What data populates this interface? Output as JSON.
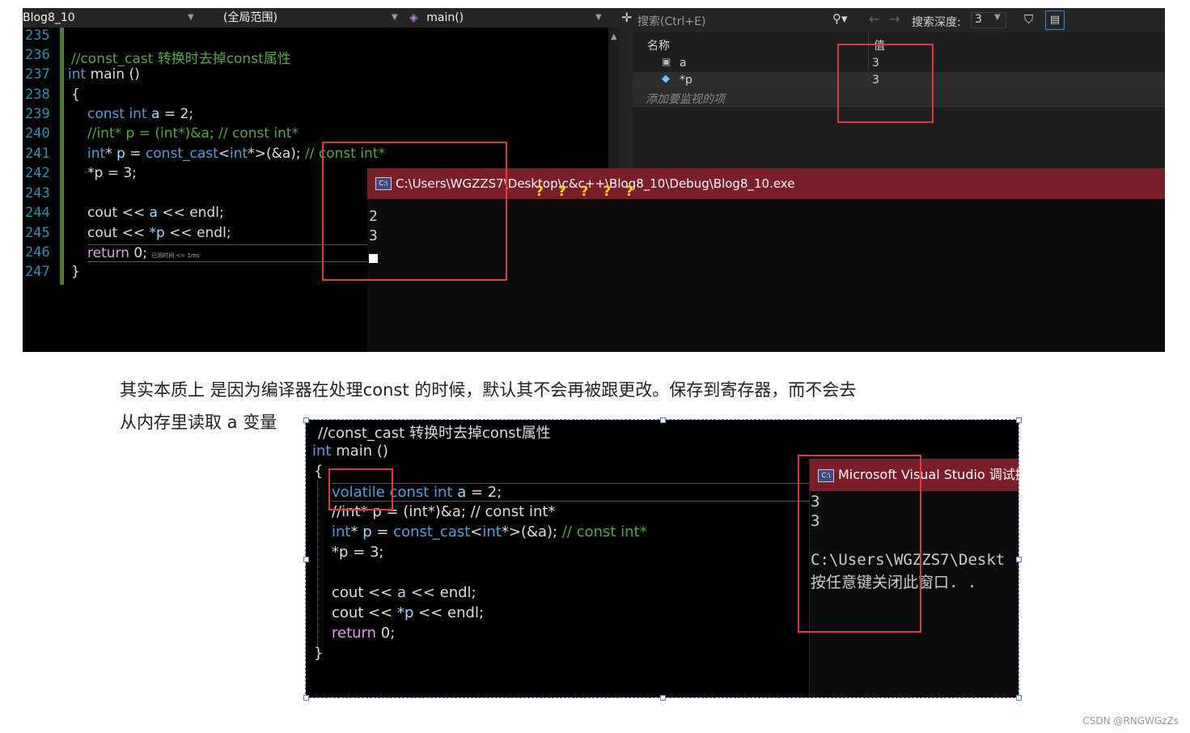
{
  "top_screenshot": {
    "nav": {
      "project": "Blog8_10",
      "scope": "(全局范围)",
      "function": "main()"
    },
    "line_numbers": [
      "235",
      "236",
      "237",
      "238",
      "239",
      "240",
      "241",
      "242",
      "243",
      "244",
      "245",
      "246",
      "247"
    ],
    "code": {
      "l236": "//const_cast 转换时去掉const属性",
      "l237_kw": "int",
      "l237_rest": " main ()",
      "l238": "{",
      "l239_kw": "const int",
      "l239_var": "a",
      "l239_rest": " = 2;",
      "l240": "//int* p = (int*)&a; // const int*",
      "l241_kw": "int",
      "l241_rest1": "* ",
      "l241_var": "p",
      "l241_rest2": " = ",
      "l241_cast": "const_cast",
      "l241_rest3": "<",
      "l241_kw2": "int",
      "l241_rest4": "*>(&a); ",
      "l241_comment": "// const int*",
      "l242": "*p = 3;",
      "l244_a": "cout << ",
      "l244_var": "a",
      "l244_b": " << endl;",
      "l245_a": "cout << ",
      "l245_var": "*p",
      "l245_b": " << endl;",
      "l246_kw": "return",
      "l246_rest": " 0;",
      "l246_hint": "已用时间 <= 1ms",
      "l247": "}"
    },
    "watch": {
      "search_placeholder": "搜索(Ctrl+E)",
      "depth_label": "搜索深度:",
      "depth_value": "3",
      "col_name": "名称",
      "col_value": "值",
      "rows": [
        {
          "name": "a",
          "value": "3"
        },
        {
          "name": "*p",
          "value": "3"
        }
      ],
      "add_placeholder": "添加要监视的项"
    },
    "console": {
      "title": "C:\\Users\\WGZZS7\\Desktop\\c&c++\\Blog8_10\\Debug\\Blog8_10.exe",
      "question_marks": "? ? ? ? ?",
      "lines": [
        "2",
        "3"
      ]
    }
  },
  "paragraph": {
    "line1": "其实本质上 是因为编译器在处理const 的时候，默认其不会再被跟更改。保存到寄存器，而不会去",
    "line2": "从内存里读取 a 变量"
  },
  "bottom_screenshot": {
    "code": {
      "comment": "//const_cast 转换时去掉const属性",
      "main_kw": "int",
      "main_rest": " main ()",
      "open": "{",
      "l1_kw": "volatile const int",
      "l1_var": "a",
      "l1_rest": " = 2;",
      "l2": "//int* p = (int*)&a; // const int*",
      "l3_kw": "int",
      "l3_rest1": "* ",
      "l3_var": "p",
      "l3_rest2": " = ",
      "l3_cast": "const_cast",
      "l3_rest3": "<",
      "l3_kw2": "int",
      "l3_rest4": "*>(&a); ",
      "l3_comment": "// const int*",
      "l4": "*p = 3;",
      "l5_a": "cout << ",
      "l5_var": "a",
      "l5_b": " << endl;",
      "l6_a": "cout << ",
      "l6_var": "*p",
      "l6_b": " << endl;",
      "l7_kw": "return",
      "l7_rest": " 0;",
      "close": "}"
    },
    "console": {
      "title": "Microsoft Visual Studio 调试控",
      "lines": [
        "3",
        "3",
        "",
        "C:\\Users\\WGZZS7\\Deskt",
        "按任意键关闭此窗口. ."
      ]
    }
  },
  "watermark": "CSDN @RNGWGzZs"
}
